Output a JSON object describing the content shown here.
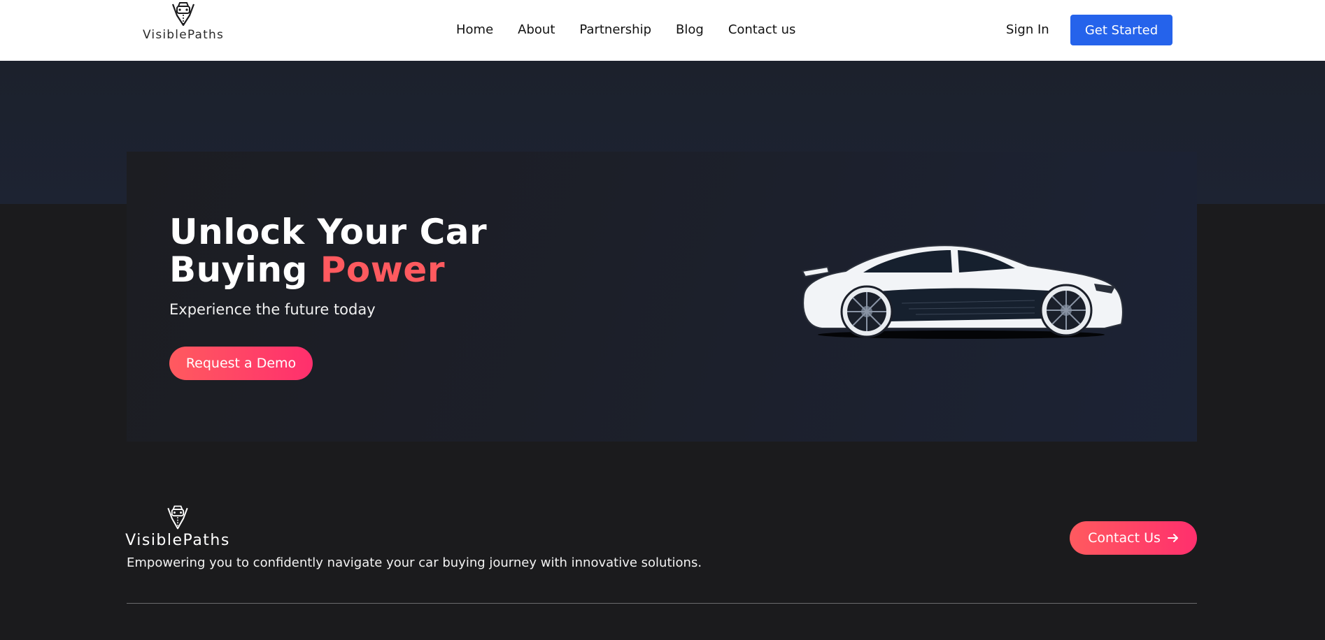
{
  "header": {
    "logo": {
      "icon": "briefcase-car-pin-icon",
      "text": "VisiblePaths"
    },
    "nav": [
      {
        "label": "Home"
      },
      {
        "label": "About"
      },
      {
        "label": "Partnership"
      },
      {
        "label": "Blog"
      },
      {
        "label": "Contact us"
      }
    ],
    "sign_in_label": "Sign In",
    "get_started_label": "Get Started"
  },
  "hero": {
    "title_line1": "Unlock Your Car",
    "title_line2_start": "Buying ",
    "title_line2_accent": "Power",
    "subtitle": "Experience the future today",
    "cta_label": "Request a Demo",
    "image": "sports-car-illustration"
  },
  "footer": {
    "logo_text": "VisiblePaths",
    "tagline": "Empowering you to confidently navigate your car buying journey with innovative solutions.",
    "contact_label": "Contact Us",
    "contact_icon": "arrow-right-icon"
  },
  "colors": {
    "header_bg": "#ffffff",
    "page_bg": "#1b1b1d",
    "hero_bg": "#1c2335",
    "primary_blue": "#2563eb",
    "accent_red": "#ff5a5f",
    "accent_pink": "#ff2f6d",
    "text_light": "#ffffff",
    "text_dark": "#111111"
  }
}
